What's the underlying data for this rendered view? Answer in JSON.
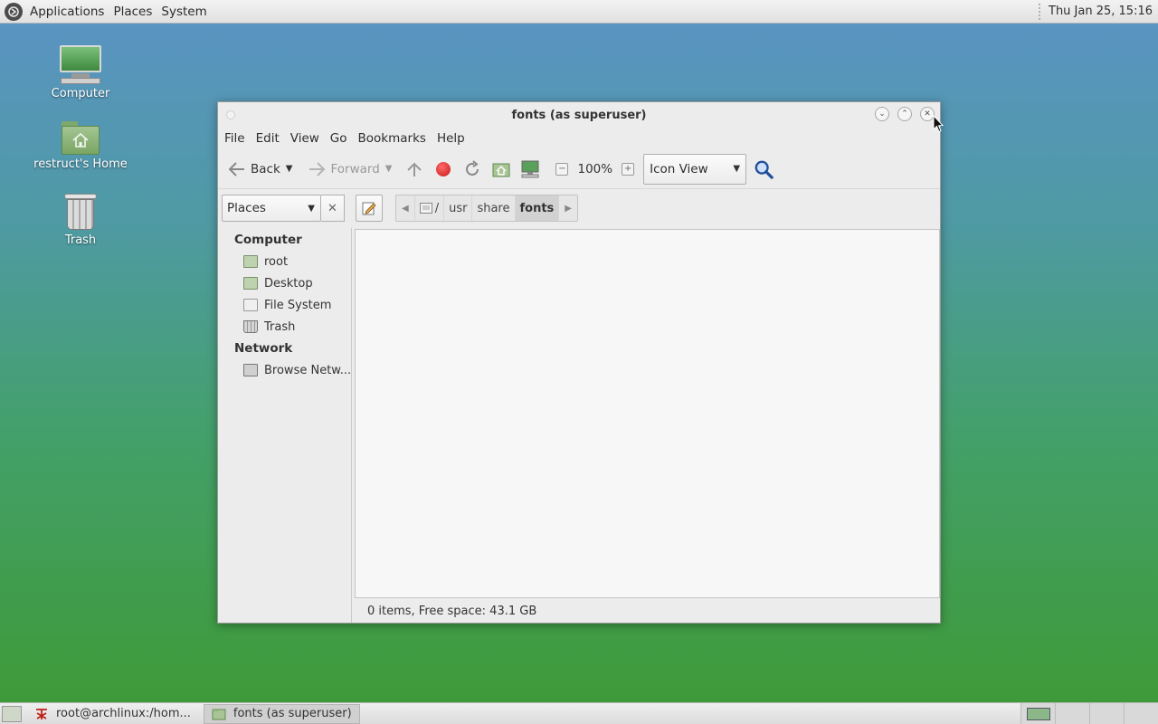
{
  "top_panel": {
    "menus": [
      "Applications",
      "Places",
      "System"
    ],
    "clock": "Thu Jan 25, 15:16"
  },
  "desktop_icons": [
    {
      "label": "Computer",
      "icon": "computer-icon"
    },
    {
      "label": "restruct's Home",
      "icon": "home-folder-icon"
    },
    {
      "label": "Trash",
      "icon": "trash-icon"
    }
  ],
  "window": {
    "title": "fonts (as superuser)",
    "menu": [
      "File",
      "Edit",
      "View",
      "Go",
      "Bookmarks",
      "Help"
    ],
    "toolbar": {
      "back_label": "Back",
      "forward_label": "Forward",
      "zoom": "100%",
      "view_mode": "Icon View"
    },
    "location": {
      "places_label": "Places",
      "path": [
        "/",
        "usr",
        "share",
        "fonts"
      ]
    },
    "sidebar": {
      "sections": [
        {
          "heading": "Computer",
          "items": [
            "root",
            "Desktop",
            "File System",
            "Trash"
          ]
        },
        {
          "heading": "Network",
          "items": [
            "Browse Netw..."
          ]
        }
      ]
    },
    "status": "0 items, Free space: 43.1 GB"
  },
  "taskbar": {
    "tasks": [
      {
        "label": "root@archlinux:/hom...",
        "icon": "terminal-icon"
      },
      {
        "label": "fonts (as superuser)",
        "icon": "folder-icon"
      }
    ]
  },
  "colors": {
    "desktop_top": "#5b93c4",
    "desktop_bottom": "#3e9a34",
    "window_bg": "#ececec"
  }
}
